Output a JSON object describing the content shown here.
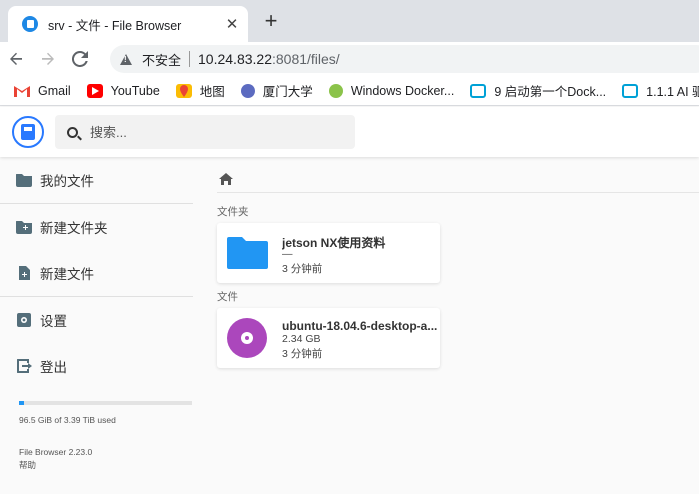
{
  "browser": {
    "tab_title": "srv - 文件 - File Browser",
    "close_glyph": "✕",
    "new_tab_glyph": "+",
    "insecure_label": "不安全",
    "url_host": "10.24.83.22",
    "url_rest": ":8081/files/",
    "bookmarks": [
      {
        "label": "Gmail",
        "icon": "gmail-icon",
        "color": "#ea4335"
      },
      {
        "label": "YouTube",
        "icon": "youtube-icon",
        "color": "#ff0000"
      },
      {
        "label": "地图",
        "icon": "maps-icon",
        "color": "#34a853"
      },
      {
        "label": "厦门大学",
        "icon": "xmu-icon",
        "color": "#5c6bc0"
      },
      {
        "label": "Windows Docker...",
        "icon": "docker-icon",
        "color": "#8bc34a"
      },
      {
        "label": "9 启动第一个Dock...",
        "icon": "bilibili-icon",
        "color": "#00a1d6"
      },
      {
        "label": "1.1.1 AI 驱...",
        "icon": "bilibili-icon",
        "color": "#00a1d6"
      }
    ]
  },
  "header": {
    "search_placeholder": "搜索..."
  },
  "sidebar": {
    "items": [
      {
        "label": "我的文件",
        "name": "sidebar-item-my-files",
        "icon": "folder-icon"
      },
      {
        "label": "新建文件夹",
        "name": "sidebar-item-new-folder",
        "icon": "create-folder-icon"
      },
      {
        "label": "新建文件",
        "name": "sidebar-item-new-file",
        "icon": "note-add-icon"
      },
      {
        "label": "设置",
        "name": "sidebar-item-settings",
        "icon": "settings-icon"
      },
      {
        "label": "登出",
        "name": "sidebar-item-logout",
        "icon": "logout-icon"
      }
    ],
    "quota_text": "96.5 GiB of 3.39 TiB used",
    "quota_fraction": 0.028,
    "version": "File Browser 2.23.0",
    "help": "帮助"
  },
  "main": {
    "folders_label": "文件夹",
    "files_label": "文件",
    "folders": [
      {
        "name": "jetson NX使用资料",
        "size": "—",
        "modified": "3 分钟前"
      }
    ],
    "files": [
      {
        "name": "ubuntu-18.04.6-desktop-a...",
        "size": "2.34 GB",
        "modified": "3 分钟前"
      }
    ]
  },
  "colors": {
    "accent": "#2979ff",
    "folder": "#2196f3",
    "disc": "#ab47bc"
  }
}
